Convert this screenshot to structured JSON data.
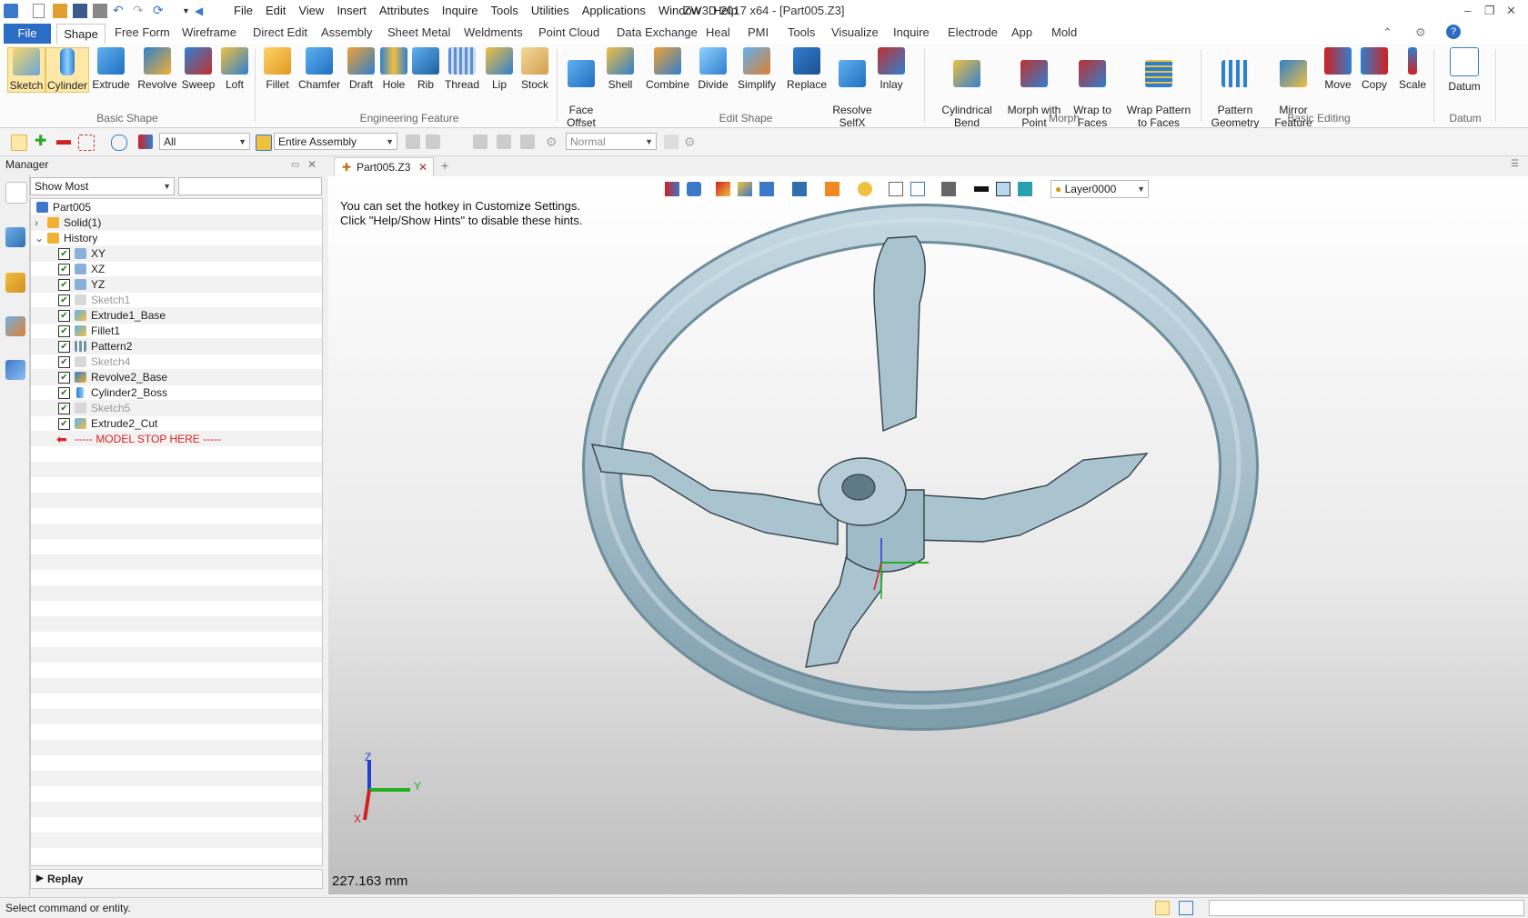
{
  "window": {
    "title": "ZW3D 2017  x64 - [Part005.Z3]",
    "menus": [
      "File",
      "Edit",
      "View",
      "Insert",
      "Attributes",
      "Inquire",
      "Tools",
      "Utilities",
      "Applications",
      "Window",
      "Help"
    ],
    "controls": {
      "minimize": "–",
      "restore": "❐",
      "close": "✕"
    }
  },
  "ribbon_tabs": [
    "File",
    "Shape",
    "Free Form",
    "Wireframe",
    "Direct Edit",
    "Assembly",
    "Sheet Metal",
    "Weldments",
    "Point Cloud",
    "Data Exchange",
    "Heal",
    "PMI",
    "Tools",
    "Visualize",
    "Inquire",
    "Electrode",
    "App",
    "Mold"
  ],
  "active_tab": "Shape",
  "ribbon": {
    "basic_shape": {
      "label": "Basic Shape",
      "buttons": [
        "Sketch",
        "Cylinder",
        "Extrude",
        "Revolve",
        "Sweep",
        "Loft"
      ]
    },
    "engineering_feature": {
      "label": "Engineering Feature",
      "buttons": [
        "Fillet",
        "Chamfer",
        "Draft",
        "Hole",
        "Rib",
        "Thread",
        "Lip",
        "Stock"
      ]
    },
    "edit_shape": {
      "label": "Edit Shape",
      "buttons": [
        "Face\nOffset",
        "Shell",
        "Combine",
        "Divide",
        "Simplify",
        "Replace",
        "Resolve\nSelfX",
        "Inlay"
      ]
    },
    "morph": {
      "label": "Morph",
      "buttons": [
        "Cylindrical\nBend",
        "Morph with\nPoint",
        "Wrap to\nFaces",
        "Wrap Pattern\nto Faces"
      ]
    },
    "basic_editing": {
      "label": "Basic Editing",
      "buttons": [
        "Pattern\nGeometry",
        "Mirror\nFeature",
        "Move",
        "Copy",
        "Scale"
      ]
    },
    "datum": {
      "label": "Datum",
      "buttons": [
        "Datum"
      ]
    }
  },
  "toolbar": {
    "filter": "All",
    "scope": "Entire Assembly",
    "mode": "Normal"
  },
  "manager": {
    "title": "Manager",
    "filter": "Show Most",
    "tree": {
      "root": "Part005",
      "solid": "Solid(1)",
      "history": "History",
      "items": [
        "XY",
        "XZ",
        "YZ",
        "Sketch1",
        "Extrude1_Base",
        "Fillet1",
        "Pattern2",
        "Sketch4",
        "Revolve2_Base",
        "Cylinder2_Boss",
        "Sketch5",
        "Extrude2_Cut"
      ],
      "stop": "----- MODEL STOP HERE -----"
    },
    "replay": "Replay"
  },
  "document": {
    "tab": "Part005.Z3",
    "hint_line1": "You can set the hotkey in Customize Settings.",
    "hint_line2": "Click \"Help/Show Hints\" to disable these hints.",
    "layer": "Layer0000",
    "measure": "227.163 mm",
    "axes": {
      "x": "X",
      "y": "Y",
      "z": "Z"
    }
  },
  "status": "Select command or entity.",
  "colors": {
    "accent": "#2b6cc4",
    "model": "#a9c3cf",
    "stop": "#e02020"
  }
}
